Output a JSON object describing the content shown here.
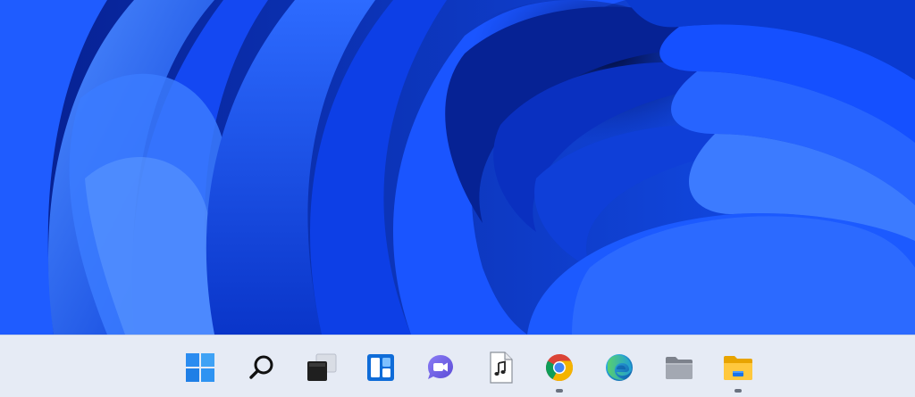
{
  "wallpaper": {
    "theme": "windows-11-bloom",
    "colors": {
      "primary": "#1a5cff",
      "deep": "#031a7a",
      "highlight": "#6aa2ff"
    }
  },
  "taskbar": {
    "background": "#e6ebf5",
    "icons": [
      {
        "id": "start",
        "icon": "windows-logo-icon",
        "running": false
      },
      {
        "id": "search",
        "icon": "search-icon",
        "running": false
      },
      {
        "id": "task-view",
        "icon": "task-view-icon",
        "running": false
      },
      {
        "id": "widgets",
        "icon": "widgets-icon",
        "running": false
      },
      {
        "id": "teams-chat",
        "icon": "teams-chat-icon",
        "running": false
      },
      {
        "id": "music-file",
        "icon": "music-file-icon",
        "running": false
      },
      {
        "id": "chrome",
        "icon": "chrome-icon",
        "running": true
      },
      {
        "id": "edge",
        "icon": "edge-icon",
        "running": false
      },
      {
        "id": "folder-gray",
        "icon": "gray-folder-icon",
        "running": false
      },
      {
        "id": "file-explorer",
        "icon": "file-explorer-icon",
        "running": true
      }
    ]
  }
}
